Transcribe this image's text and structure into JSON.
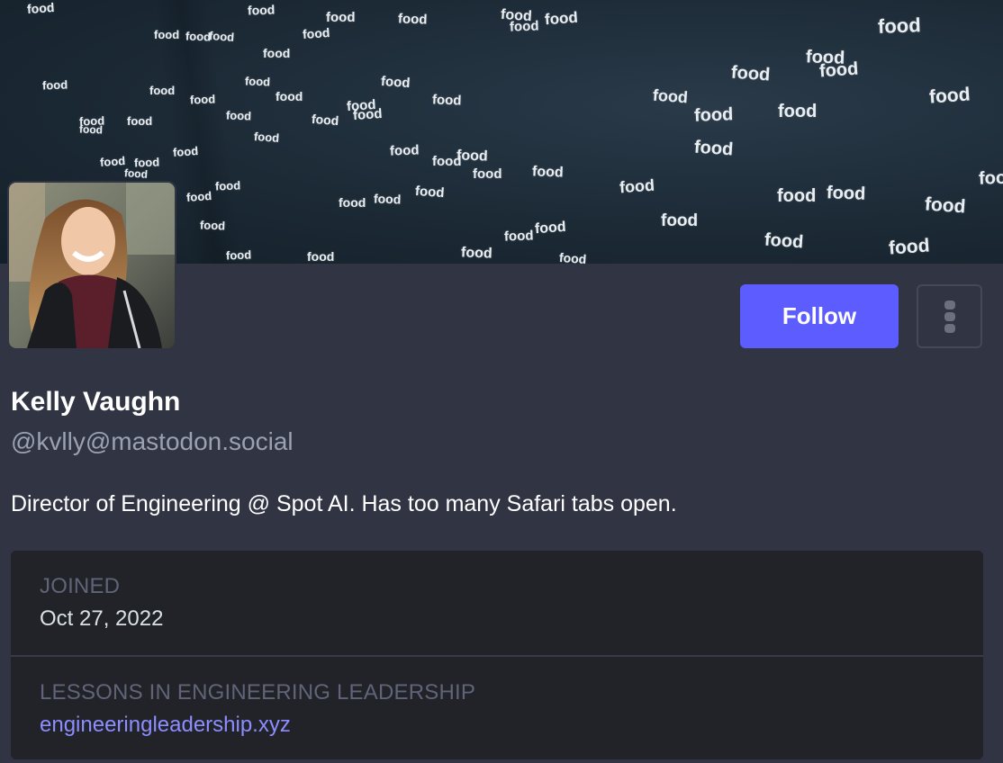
{
  "header": {
    "word": "food"
  },
  "profile": {
    "display_name": "Kelly Vaughn",
    "handle": "@kvlly@mastodon.social",
    "bio": "Director of Engineering @ Spot AI. Has too many Safari tabs open."
  },
  "actions": {
    "follow_label": "Follow",
    "more_icon": "vertical-ellipsis"
  },
  "fields": [
    {
      "label": "JOINED",
      "value": "Oct 27, 2022"
    },
    {
      "label": "LESSONS IN ENGINEERING LEADERSHIP",
      "value": "engineeringleadership.xyz"
    }
  ],
  "colors": {
    "accent": "#5d5cff",
    "link": "#8c8dff",
    "background": "#313543",
    "field_background": "#222328"
  }
}
